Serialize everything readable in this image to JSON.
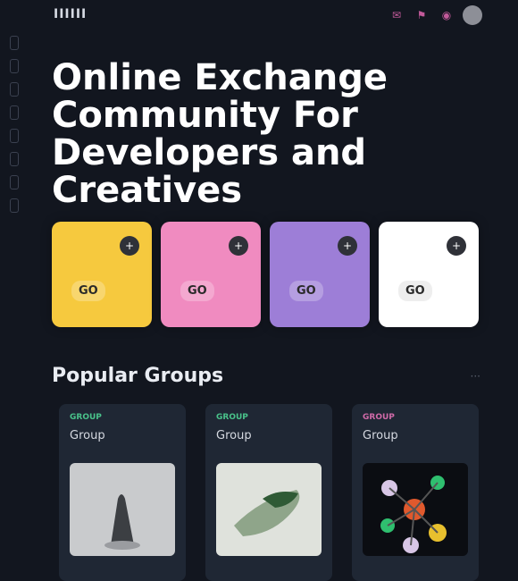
{
  "header": {
    "logo": "IIIIII",
    "icons": [
      "chat-icon",
      "flag-icon",
      "bell-icon",
      "avatar"
    ]
  },
  "hero": {
    "title": "Online Exchange Community For Developers and Creatives"
  },
  "feature_cards": [
    {
      "label": "GO",
      "color": "#f6c93e",
      "badge": "+"
    },
    {
      "label": "GO",
      "color": "#f08bc0",
      "badge": "+"
    },
    {
      "label": "GO",
      "color": "#9d7ed7",
      "badge": "+"
    },
    {
      "label": "GO",
      "color": "#ffffff",
      "badge": "+"
    }
  ],
  "section": {
    "title": "Popular Groups",
    "more": "···"
  },
  "groups": [
    {
      "tag": "GROUP",
      "tag_color": "#49c28a",
      "name": "Group"
    },
    {
      "tag": "GROUP",
      "tag_color": "#49c28a",
      "name": "Group"
    },
    {
      "tag": "GROUP",
      "tag_color": "#d06aa8",
      "name": "Group"
    }
  ]
}
